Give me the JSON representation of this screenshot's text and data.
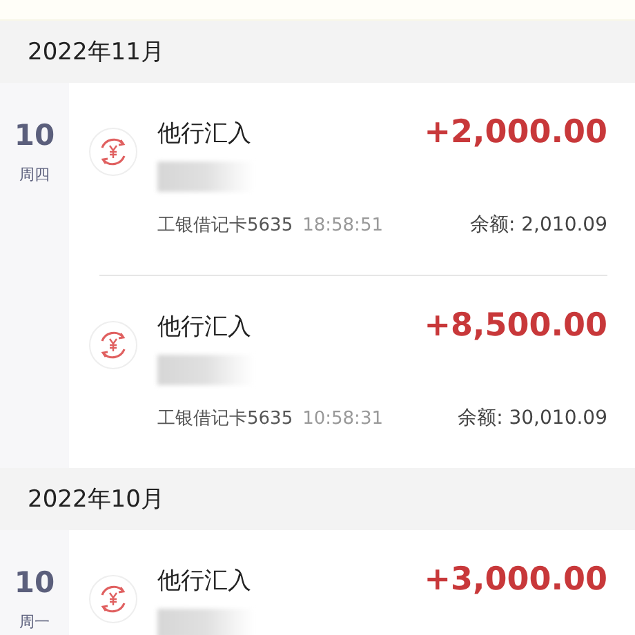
{
  "months": [
    {
      "label": "2022年11月",
      "days": [
        {
          "day": "10",
          "weekday": "周四",
          "transactions": [
            {
              "title": "他行汇入",
              "amount": "+2,000.00",
              "card": "工银借记卡5635",
              "time": "18:58:51",
              "balance": "余额: 2,010.09"
            },
            {
              "title": "他行汇入",
              "amount": "+8,500.00",
              "card": "工银借记卡5635",
              "time": "10:58:31",
              "balance": "余额: 30,010.09"
            }
          ]
        }
      ]
    },
    {
      "label": "2022年10月",
      "days": [
        {
          "day": "10",
          "weekday": "周一",
          "transactions": [
            {
              "title": "他行汇入",
              "amount": "+3,000.00"
            }
          ]
        }
      ]
    }
  ]
}
